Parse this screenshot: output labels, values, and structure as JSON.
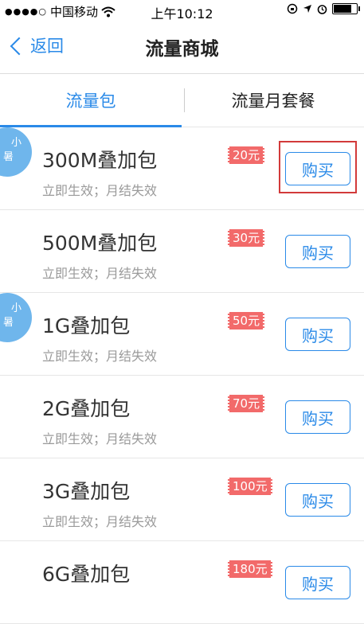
{
  "status_bar": {
    "carrier": "中国移动",
    "time": "上午10:12"
  },
  "nav": {
    "back_label": "返回",
    "title": "流量商城"
  },
  "tabs": [
    {
      "label": "流量包",
      "active": true
    },
    {
      "label": "流量月套餐",
      "active": false
    }
  ],
  "badge_text": [
    "小",
    "暑"
  ],
  "items": [
    {
      "name": "300M叠加包",
      "desc": "立即生效；月结失效",
      "price": "20元",
      "buy": "购买"
    },
    {
      "name": "500M叠加包",
      "desc": "立即生效；月结失效",
      "price": "30元",
      "buy": "购买"
    },
    {
      "name": "1G叠加包",
      "desc": "立即生效；月结失效",
      "price": "50元",
      "buy": "购买"
    },
    {
      "name": "2G叠加包",
      "desc": "立即生效；月结失效",
      "price": "70元",
      "buy": "购买"
    },
    {
      "name": "3G叠加包",
      "desc": "立即生效；月结失效",
      "price": "100元",
      "buy": "购买"
    },
    {
      "name": "6G叠加包",
      "desc": "",
      "price": "180元",
      "buy": "购买"
    }
  ],
  "colors": {
    "accent": "#2a8ae8",
    "price_tag": "#f26a6a",
    "highlight_box": "#d23a3a"
  }
}
